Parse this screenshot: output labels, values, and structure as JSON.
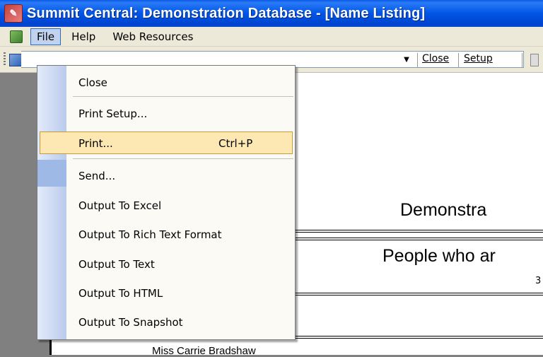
{
  "window": {
    "title": "Summit Central: Demonstration Database - [Name Listing]"
  },
  "menubar": {
    "items": [
      "File",
      "Help",
      "Web Resources"
    ]
  },
  "toolbar": {
    "close_label": "Close",
    "setup_label": "Setup"
  },
  "file_menu": {
    "close": "Close",
    "print_setup": "Print Setup...",
    "print": "Print...",
    "print_shortcut": "Ctrl+P",
    "send": "Send...",
    "output_excel": "Output To Excel",
    "output_rtf": "Output To Rich Text Format",
    "output_text": "Output To Text",
    "output_html": "Output To HTML",
    "output_snapshot": "Output To Snapshot"
  },
  "report": {
    "title_fragment": "Demonstra",
    "subtitle_fragment": "People who ar",
    "number_fragment": "3",
    "row_fragment": "Miss Carrie Bradshaw"
  }
}
